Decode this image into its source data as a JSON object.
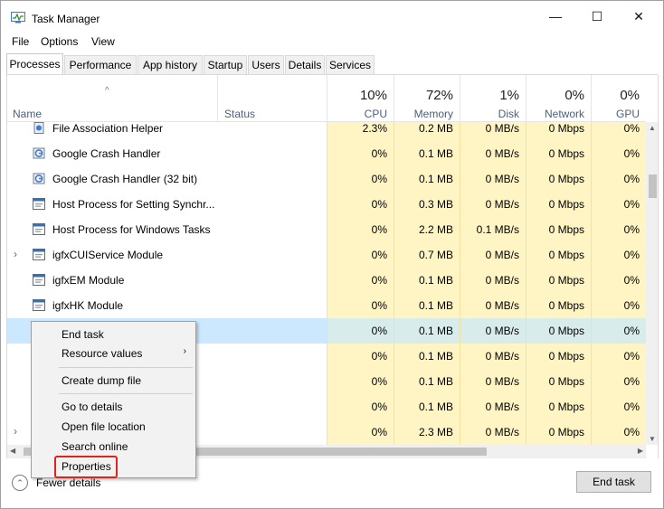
{
  "window": {
    "title": "Task Manager",
    "minimize": "—",
    "maximize": "☐",
    "close": "✕"
  },
  "menu": [
    "File",
    "Options",
    "View"
  ],
  "tabs": [
    "Processes",
    "Performance",
    "App history",
    "Startup",
    "Users",
    "Details",
    "Services"
  ],
  "header": {
    "sort_caret": "^",
    "name": "Name",
    "status": "Status",
    "cpu_pct": "10%",
    "cpu": "CPU",
    "memory_pct": "72%",
    "memory": "Memory",
    "disk_pct": "1%",
    "disk": "Disk",
    "network_pct": "0%",
    "network": "Network",
    "gpu_pct": "0%",
    "gpu": "GPU"
  },
  "rows": [
    {
      "name": "File Association Helper",
      "cpu": "2.3%",
      "memory": "0.2 MB",
      "disk": "0 MB/s",
      "network": "0 Mbps",
      "gpu": "0%",
      "icon": "file-assoc-icon"
    },
    {
      "name": "Google Crash Handler",
      "cpu": "0%",
      "memory": "0.1 MB",
      "disk": "0 MB/s",
      "network": "0 Mbps",
      "gpu": "0%",
      "icon": "google-icon"
    },
    {
      "name": "Google Crash Handler (32 bit)",
      "cpu": "0%",
      "memory": "0.1 MB",
      "disk": "0 MB/s",
      "network": "0 Mbps",
      "gpu": "0%",
      "icon": "google-icon"
    },
    {
      "name": "Host Process for Setting Synchr...",
      "cpu": "0%",
      "memory": "0.3 MB",
      "disk": "0 MB/s",
      "network": "0 Mbps",
      "gpu": "0%",
      "icon": "process-icon"
    },
    {
      "name": "Host Process for Windows Tasks",
      "cpu": "0%",
      "memory": "2.2 MB",
      "disk": "0.1 MB/s",
      "network": "0 Mbps",
      "gpu": "0%",
      "icon": "process-icon"
    },
    {
      "name": "igfxCUIService Module",
      "cpu": "0%",
      "memory": "0.7 MB",
      "disk": "0 MB/s",
      "network": "0 Mbps",
      "gpu": "0%",
      "icon": "process-icon",
      "expander": "›"
    },
    {
      "name": "igfxEM Module",
      "cpu": "0%",
      "memory": "0.1 MB",
      "disk": "0 MB/s",
      "network": "0 Mbps",
      "gpu": "0%",
      "icon": "process-icon"
    },
    {
      "name": "igfxHK Module",
      "cpu": "0%",
      "memory": "0.1 MB",
      "disk": "0 MB/s",
      "network": "0 Mbps",
      "gpu": "0%",
      "icon": "process-icon"
    },
    {
      "name": "",
      "cpu": "0%",
      "memory": "0.1 MB",
      "disk": "0 MB/s",
      "network": "0 Mbps",
      "gpu": "0%",
      "selected": true
    },
    {
      "name": "",
      "cpu": "0%",
      "memory": "0.1 MB",
      "disk": "0 MB/s",
      "network": "0 Mbps",
      "gpu": "0%"
    },
    {
      "name": "",
      "cpu": "0%",
      "memory": "0.1 MB",
      "disk": "0 MB/s",
      "network": "0 Mbps",
      "gpu": "0%"
    },
    {
      "name": "",
      "cpu": "0%",
      "memory": "0.1 MB",
      "disk": "0 MB/s",
      "network": "0 Mbps",
      "gpu": "0%"
    },
    {
      "name": "",
      "cpu": "0%",
      "memory": "2.3 MB",
      "disk": "0 MB/s",
      "network": "0 Mbps",
      "gpu": "0%",
      "expander": "›"
    }
  ],
  "context_menu": {
    "items": [
      "End task",
      "Resource values",
      "Create dump file",
      "Go to details",
      "Open file location",
      "Search online",
      "Properties"
    ],
    "submenu_arrow": "›"
  },
  "footer": {
    "fewer_details": "Fewer details",
    "end_task": "End task"
  },
  "colors": {
    "highlight_box": "#e0241c",
    "selected_row": "#cce8ff",
    "heat_cell": "#fff4c4"
  }
}
